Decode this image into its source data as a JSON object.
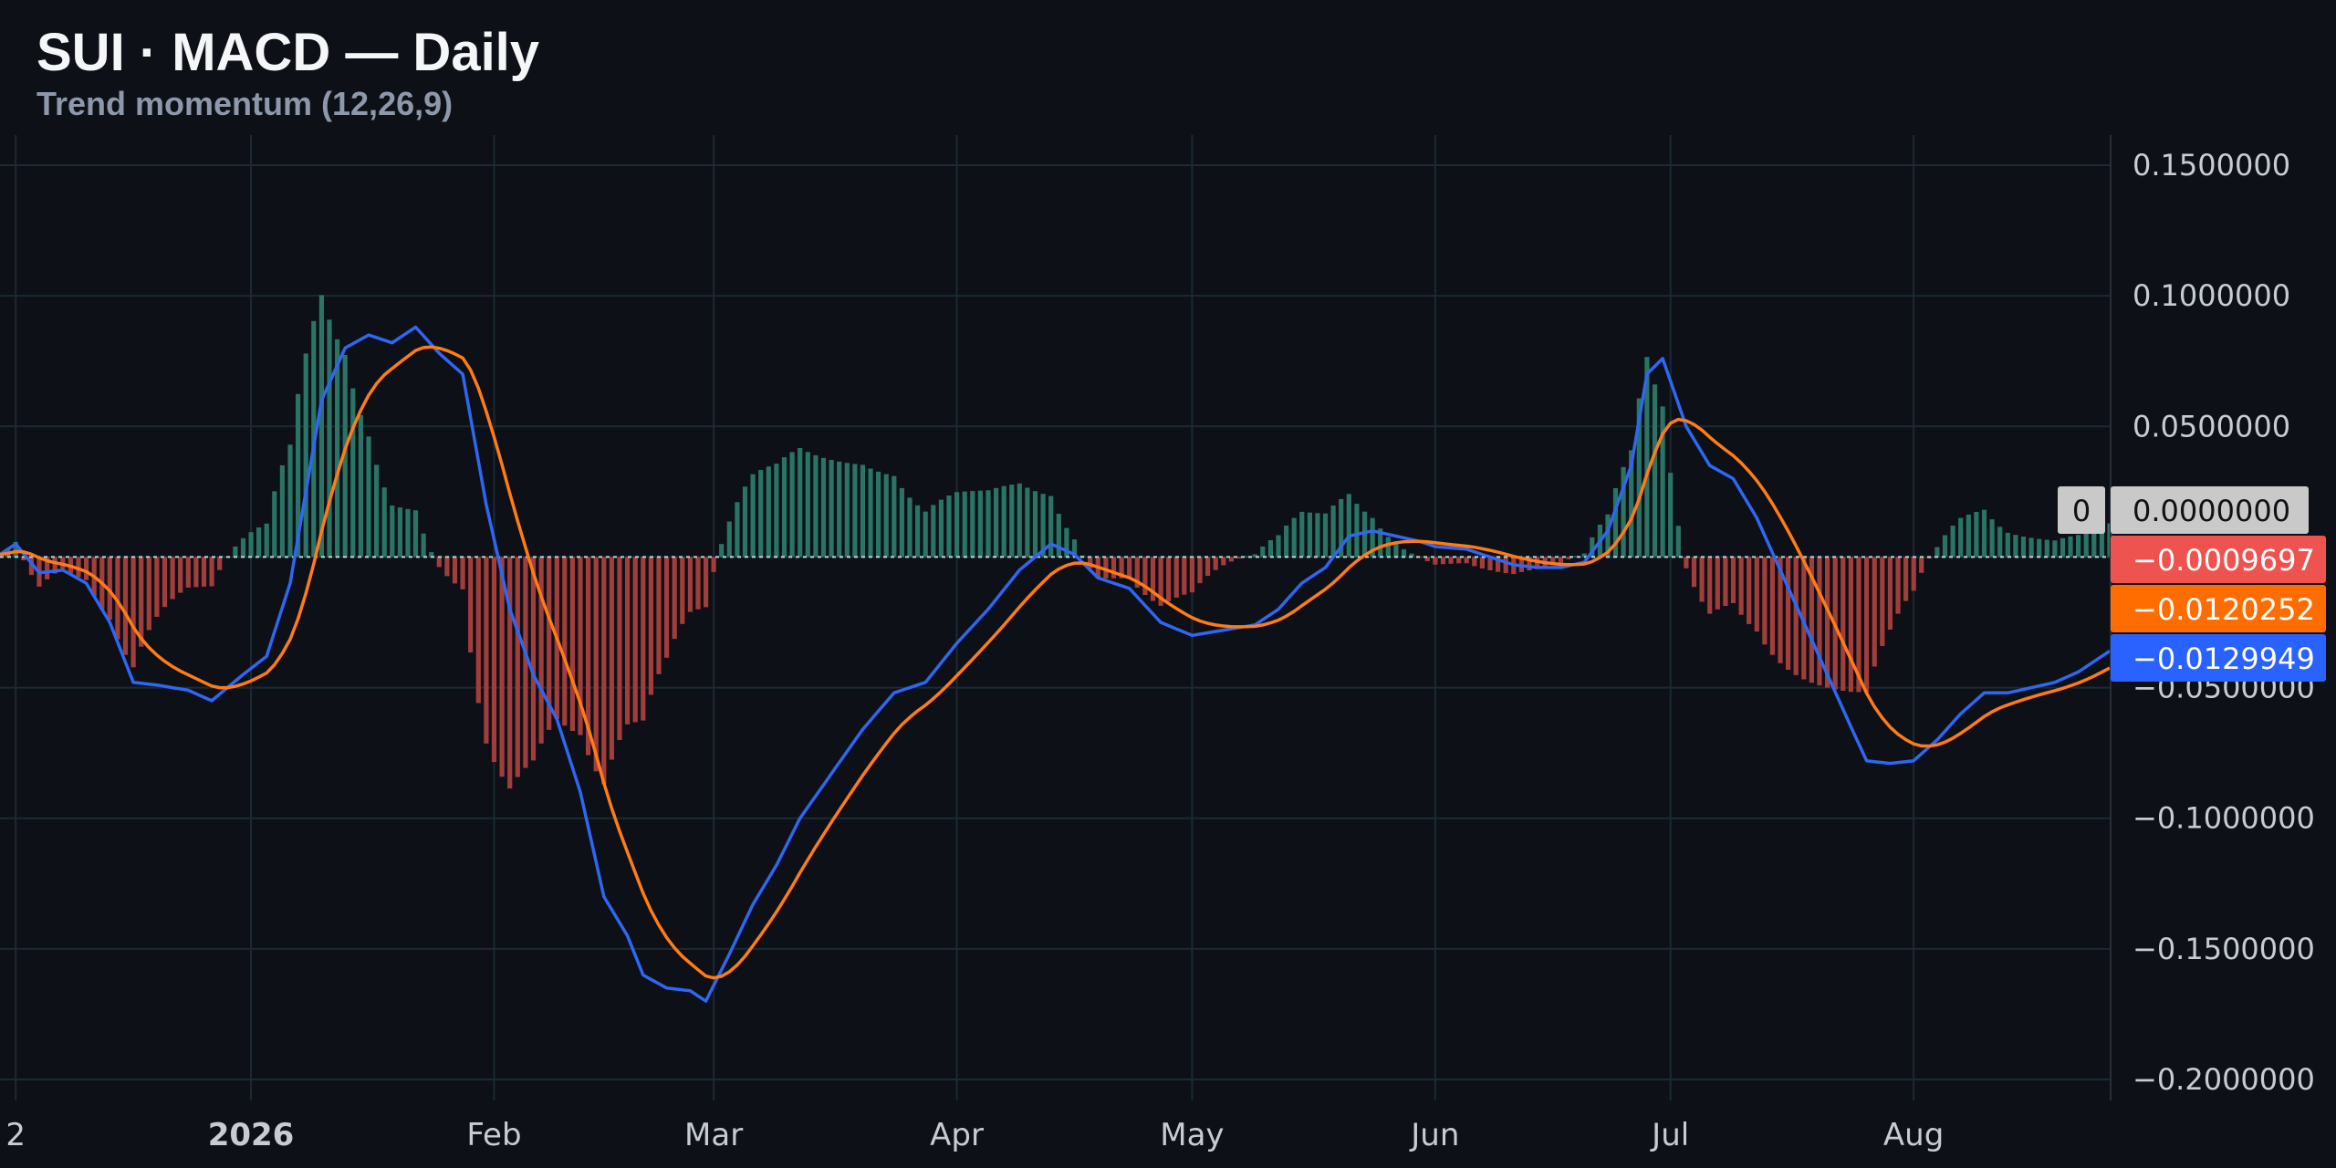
{
  "header": {
    "title": "SUI · MACD — Daily",
    "subtitle": "Trend momentum (12,26,9)"
  },
  "colors": {
    "background": "#0d1017",
    "grid": "#1b2a33",
    "macd": "#2f66f2",
    "signal": "#ff7b17",
    "histogram_positive": "#2a7466",
    "histogram_negative": "#a13e3b",
    "zero_line": "#c9cfd8",
    "axis_text": "#c7ccd4"
  },
  "chart_data": {
    "type": "line",
    "title": "SUI · MACD — Daily",
    "subtitle": "Trend momentum (12,26,9)",
    "ylim": [
      -0.2,
      0.15
    ],
    "y_ticks": [
      "0.1500000",
      "0.1000000",
      "0.0500000",
      "0.0000000",
      "−0.0500000",
      "−0.1000000",
      "−0.1500000",
      "−0.2000000"
    ],
    "y_tick_values": [
      0.15,
      0.1,
      0.05,
      0,
      -0.05,
      -0.1,
      -0.15,
      -0.2
    ],
    "x_date_range": [
      "2025-11-30",
      "2026-08-26"
    ],
    "x_ticks": [
      {
        "label": "2",
        "date": "2025-12-02",
        "bold": false
      },
      {
        "label": "2026",
        "date": "2026-01-01",
        "bold": true
      },
      {
        "label": "Feb",
        "date": "2026-02-01",
        "bold": false
      },
      {
        "label": "Mar",
        "date": "2026-03-01",
        "bold": false
      },
      {
        "label": "Apr",
        "date": "2026-04-01",
        "bold": false
      },
      {
        "label": "May",
        "date": "2026-05-01",
        "bold": false
      },
      {
        "label": "Jun",
        "date": "2026-06-01",
        "bold": false
      },
      {
        "label": "Jul",
        "date": "2026-07-01",
        "bold": false
      },
      {
        "label": "Aug",
        "date": "2026-08-01",
        "bold": false
      }
    ],
    "grid": true,
    "zero_marker": {
      "label": "0",
      "value": "0.0000000"
    },
    "last_values": {
      "histogram": "−0.0009697",
      "signal": "−0.0120252",
      "macd": "−0.0129949"
    },
    "series": [
      {
        "key": "macd",
        "points": [
          [
            "2025-11-30",
            0.001
          ],
          [
            "2025-12-02",
            0.005
          ],
          [
            "2025-12-05",
            -0.006
          ],
          [
            "2025-12-08",
            -0.005
          ],
          [
            "2025-12-11",
            -0.01
          ],
          [
            "2025-12-14",
            -0.025
          ],
          [
            "2025-12-17",
            -0.048
          ],
          [
            "2025-12-20",
            -0.049
          ],
          [
            "2025-12-24",
            -0.051
          ],
          [
            "2025-12-27",
            -0.055
          ],
          [
            "2025-12-31",
            -0.045
          ],
          [
            "2026-01-03",
            -0.038
          ],
          [
            "2026-01-06",
            -0.01
          ],
          [
            "2026-01-08",
            0.025
          ],
          [
            "2026-01-10",
            0.06
          ],
          [
            "2026-01-13",
            0.08
          ],
          [
            "2026-01-16",
            0.085
          ],
          [
            "2026-01-19",
            0.082
          ],
          [
            "2026-01-22",
            0.088
          ],
          [
            "2026-01-25",
            0.078
          ],
          [
            "2026-01-28",
            0.07
          ],
          [
            "2026-01-31",
            0.02
          ],
          [
            "2026-02-03",
            -0.02
          ],
          [
            "2026-02-06",
            -0.045
          ],
          [
            "2026-02-09",
            -0.062
          ],
          [
            "2026-02-12",
            -0.09
          ],
          [
            "2026-02-15",
            -0.13
          ],
          [
            "2026-02-18",
            -0.145
          ],
          [
            "2026-02-20",
            -0.16
          ],
          [
            "2026-02-23",
            -0.165
          ],
          [
            "2026-02-26",
            -0.166
          ],
          [
            "2026-02-28",
            -0.17
          ],
          [
            "2026-03-03",
            -0.152
          ],
          [
            "2026-03-06",
            -0.133
          ],
          [
            "2026-03-09",
            -0.118
          ],
          [
            "2026-03-12",
            -0.1
          ],
          [
            "2026-03-16",
            -0.083
          ],
          [
            "2026-03-20",
            -0.066
          ],
          [
            "2026-03-24",
            -0.052
          ],
          [
            "2026-03-28",
            -0.048
          ],
          [
            "2026-04-01",
            -0.033
          ],
          [
            "2026-04-05",
            -0.02
          ],
          [
            "2026-04-09",
            -0.005
          ],
          [
            "2026-04-13",
            0.005
          ],
          [
            "2026-04-16",
            0.001
          ],
          [
            "2026-04-19",
            -0.008
          ],
          [
            "2026-04-23",
            -0.012
          ],
          [
            "2026-04-27",
            -0.025
          ],
          [
            "2026-05-01",
            -0.03
          ],
          [
            "2026-05-05",
            -0.028
          ],
          [
            "2026-05-09",
            -0.026
          ],
          [
            "2026-05-12",
            -0.02
          ],
          [
            "2026-05-15",
            -0.01
          ],
          [
            "2026-05-18",
            -0.004
          ],
          [
            "2026-05-21",
            0.008
          ],
          [
            "2026-05-24",
            0.01
          ],
          [
            "2026-05-27",
            0.008
          ],
          [
            "2026-05-30",
            0.006
          ],
          [
            "2026-06-01",
            0.004
          ],
          [
            "2026-06-05",
            0.003
          ],
          [
            "2026-06-08",
            0.0
          ],
          [
            "2026-06-11",
            -0.003
          ],
          [
            "2026-06-14",
            -0.004
          ],
          [
            "2026-06-17",
            -0.004
          ],
          [
            "2026-06-20",
            -0.002
          ],
          [
            "2026-06-23",
            0.01
          ],
          [
            "2026-06-26",
            0.035
          ],
          [
            "2026-06-28",
            0.07
          ],
          [
            "2026-06-30",
            0.076
          ],
          [
            "2026-07-03",
            0.05
          ],
          [
            "2026-07-06",
            0.035
          ],
          [
            "2026-07-09",
            0.03
          ],
          [
            "2026-07-12",
            0.015
          ],
          [
            "2026-07-15",
            -0.005
          ],
          [
            "2026-07-18",
            -0.025
          ],
          [
            "2026-07-21",
            -0.045
          ],
          [
            "2026-07-24",
            -0.065
          ],
          [
            "2026-07-26",
            -0.078
          ],
          [
            "2026-07-29",
            -0.079
          ],
          [
            "2026-08-01",
            -0.078
          ],
          [
            "2026-08-04",
            -0.07
          ],
          [
            "2026-08-07",
            -0.06
          ],
          [
            "2026-08-10",
            -0.052
          ],
          [
            "2026-08-13",
            -0.052
          ],
          [
            "2026-08-16",
            -0.05
          ],
          [
            "2026-08-19",
            -0.048
          ],
          [
            "2026-08-22",
            -0.044
          ],
          [
            "2026-08-26",
            -0.036
          ]
        ]
      }
    ]
  }
}
